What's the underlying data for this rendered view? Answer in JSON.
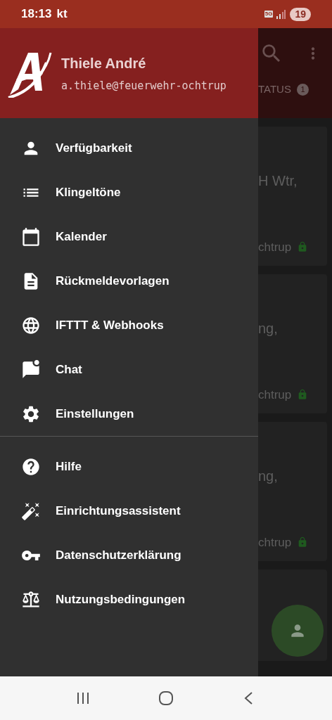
{
  "status_bar": {
    "time": "18:13",
    "carrier": "kt",
    "network": "5G",
    "battery": "19"
  },
  "drawer": {
    "name": "Thiele André",
    "email": "a.thiele@feuerwehr-ochtrup",
    "sections": [
      {
        "items": [
          {
            "label": "Verfügbarkeit"
          },
          {
            "label": "Klingeltöne"
          },
          {
            "label": "Kalender"
          },
          {
            "label": "Rückmeldevorlagen"
          },
          {
            "label": "IFTTT & Webhooks"
          },
          {
            "label": "Chat"
          },
          {
            "label": "Einstellungen"
          }
        ]
      },
      {
        "items": [
          {
            "label": "Hilfe"
          },
          {
            "label": "Einrichtungsassistent"
          },
          {
            "label": "Datenschutzerklärung"
          },
          {
            "label": "Nutzungsbedingungen"
          }
        ]
      }
    ]
  },
  "background": {
    "tab": "TATUS",
    "tab_badge": "1",
    "cards": [
      {
        "line_1": "H Wtr,",
        "line_2": "chtrup"
      },
      {
        "line_1": "ng,",
        "line_2": "chtrup"
      },
      {
        "line_1": "ng,",
        "line_2": "chtrup"
      }
    ]
  }
}
